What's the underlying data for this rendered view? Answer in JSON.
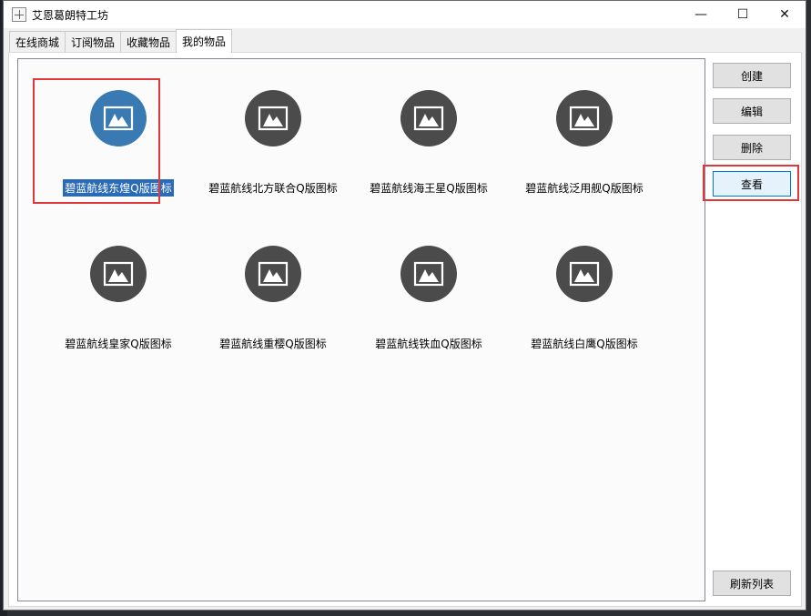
{
  "window": {
    "title": "艾恩葛朗特工坊",
    "controls": {
      "minimize": "—",
      "maximize": "☐",
      "close": "✕"
    }
  },
  "tabs": [
    {
      "label": "在线商城",
      "active": false
    },
    {
      "label": "订阅物品",
      "active": false
    },
    {
      "label": "收藏物品",
      "active": false
    },
    {
      "label": "我的物品",
      "active": true
    }
  ],
  "items": [
    {
      "label": "碧蓝航线东煌Q版图标",
      "selected": true
    },
    {
      "label": "碧蓝航线北方联合Q版图标",
      "selected": false
    },
    {
      "label": "碧蓝航线海王星Q版图标",
      "selected": false
    },
    {
      "label": "碧蓝航线泛用舰Q版图标",
      "selected": false
    },
    {
      "label": "碧蓝航线皇家Q版图标",
      "selected": false
    },
    {
      "label": "碧蓝航线重樱Q版图标",
      "selected": false
    },
    {
      "label": "碧蓝航线铁血Q版图标",
      "selected": false
    },
    {
      "label": "碧蓝航线白鹰Q版图标",
      "selected": false
    }
  ],
  "buttons": {
    "create": "创建",
    "edit": "编辑",
    "delete": "删除",
    "view": "查看",
    "refresh": "刷新列表"
  },
  "colors": {
    "accent": "#3a7ab3",
    "highlight": "#e0383a",
    "icon_bg": "#4b4b4b"
  }
}
